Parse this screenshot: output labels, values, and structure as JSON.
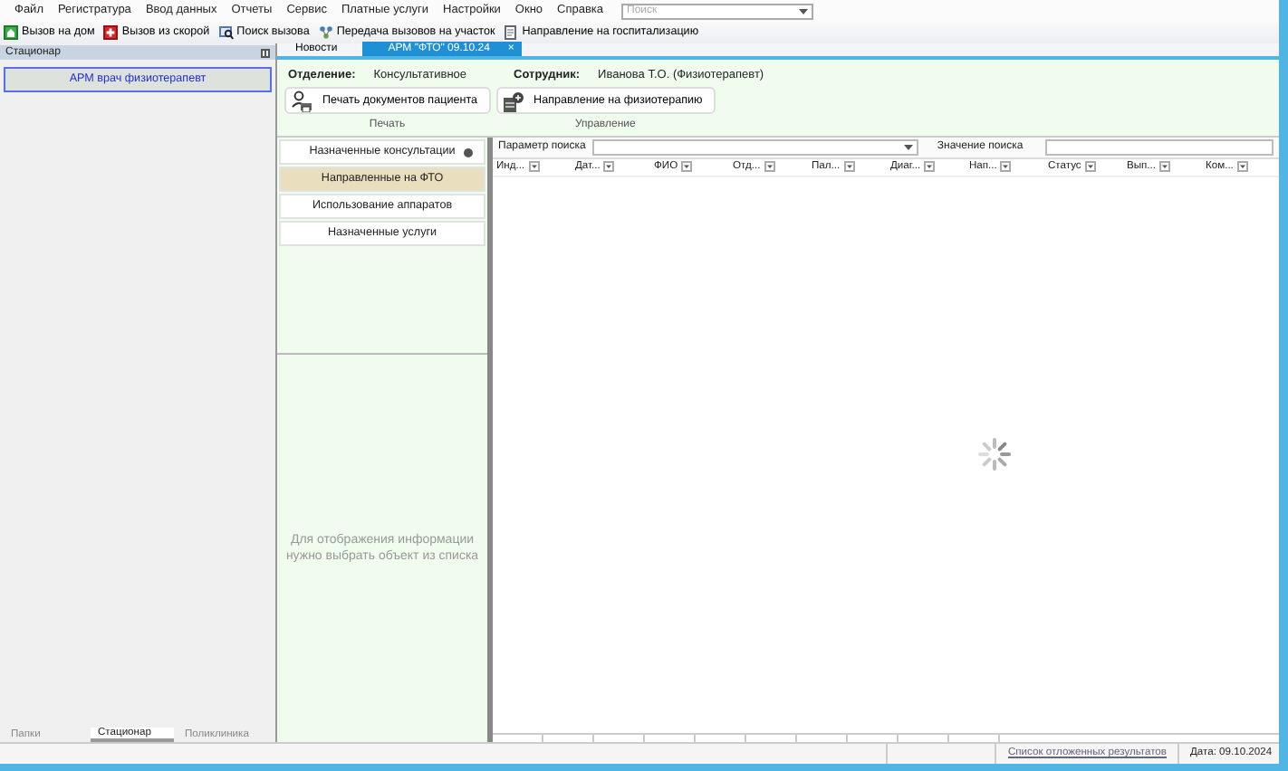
{
  "menu": [
    {
      "label": "Файл"
    },
    {
      "label": "Регистратура"
    },
    {
      "label": "Ввод данных"
    },
    {
      "label": "Отчеты"
    },
    {
      "label": "Сервис"
    },
    {
      "label": "Платные услуги"
    },
    {
      "label": "Настройки"
    },
    {
      "label": "Окно"
    },
    {
      "label": "Справка"
    }
  ],
  "search": {
    "placeholder": "Поиск"
  },
  "toolbar": [
    {
      "label": "Вызов на дом"
    },
    {
      "label": "Вызов из скорой"
    },
    {
      "label": "Поиск вызова"
    },
    {
      "label": "Передача вызовов на участок"
    },
    {
      "label": "Направление на госпитализацию"
    }
  ],
  "left_panel": {
    "title": "Стационар",
    "items": [
      {
        "label": "АРМ врач физиотерапевт",
        "selected": true
      }
    ],
    "tabs": [
      {
        "label": "Папки",
        "selected": false
      },
      {
        "label": "Стационар",
        "selected": true
      },
      {
        "label": "Поликлиника",
        "selected": false
      }
    ]
  },
  "doc_tabs": [
    {
      "label": "Новости",
      "selected": false
    },
    {
      "label": "АРМ \"ФТО\" 09.10.24",
      "selected": true,
      "close": "×"
    }
  ],
  "info": [
    {
      "label": "Отделение:",
      "value": "Консультативное"
    },
    {
      "label": "Сотрудник:",
      "value": "Иванова Т.О. (Физиотерапевт)"
    }
  ],
  "actions": [
    {
      "label": "Печать документов пациента",
      "group": "Печать"
    },
    {
      "label": "Направление на физиотерапию",
      "group": "Управление"
    }
  ],
  "nav_items": [
    {
      "label": "Назначенные консультации",
      "selected": false,
      "marked": true
    },
    {
      "label": "Направленные на ФТО",
      "selected": true,
      "marked": false
    },
    {
      "label": "Использование аппаратов",
      "selected": false,
      "marked": false
    },
    {
      "label": "Назначенные услуги",
      "selected": false,
      "marked": false
    }
  ],
  "empty_message": "Для отображения информации нужно выбрать объект из списка",
  "search_param": {
    "label": "Параметр поиска"
  },
  "search_value": {
    "label": "Значение поиска"
  },
  "columns": [
    {
      "label": "Инд..."
    },
    {
      "label": "Дат..."
    },
    {
      "label": "ФИО"
    },
    {
      "label": "Отд..."
    },
    {
      "label": "Пал..."
    },
    {
      "label": "Диаг..."
    },
    {
      "label": "Нап..."
    },
    {
      "label": "Статус"
    },
    {
      "label": "Вып..."
    },
    {
      "label": "Ком..."
    }
  ],
  "loading": true,
  "status_bar": {
    "link": "Список отложенных результатов",
    "date": "Дата: 09.10.2024"
  }
}
